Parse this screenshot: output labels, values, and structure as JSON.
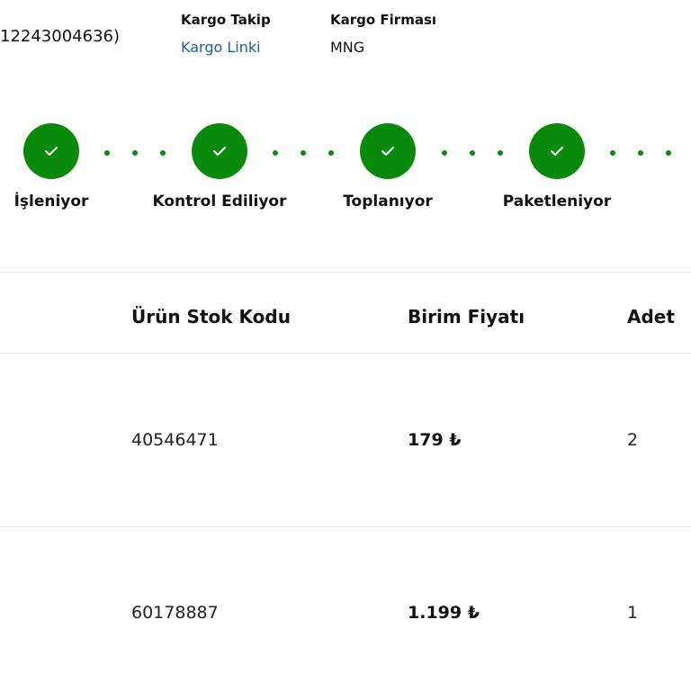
{
  "order": {
    "id_text": "12243004636)"
  },
  "shipping": {
    "tracking_label": "Kargo Takip",
    "tracking_link": "Kargo Linki",
    "carrier_label": "Kargo Firması",
    "carrier_value": "MNG"
  },
  "steps": [
    {
      "label": "İşleniyor",
      "status": "completed",
      "icon": "check-icon"
    },
    {
      "label": "Kontrol Ediliyor",
      "status": "completed",
      "icon": "check-icon"
    },
    {
      "label": "Toplanıyor",
      "status": "completed",
      "icon": "check-icon"
    },
    {
      "label": "Paketleniyor",
      "status": "completed",
      "icon": "check-icon"
    }
  ],
  "table": {
    "headers": [
      "Ürün Stok Kodu",
      "Birim Fiyatı",
      "Adet"
    ],
    "rows": [
      {
        "sku": "40546471",
        "price": "179 ₺",
        "qty": "2"
      },
      {
        "sku": "60178887",
        "price": "1.199 ₺",
        "qty": "1"
      }
    ]
  },
  "colors": {
    "accent_green": "#0a8a0a",
    "link_blue": "#1f5f99"
  }
}
